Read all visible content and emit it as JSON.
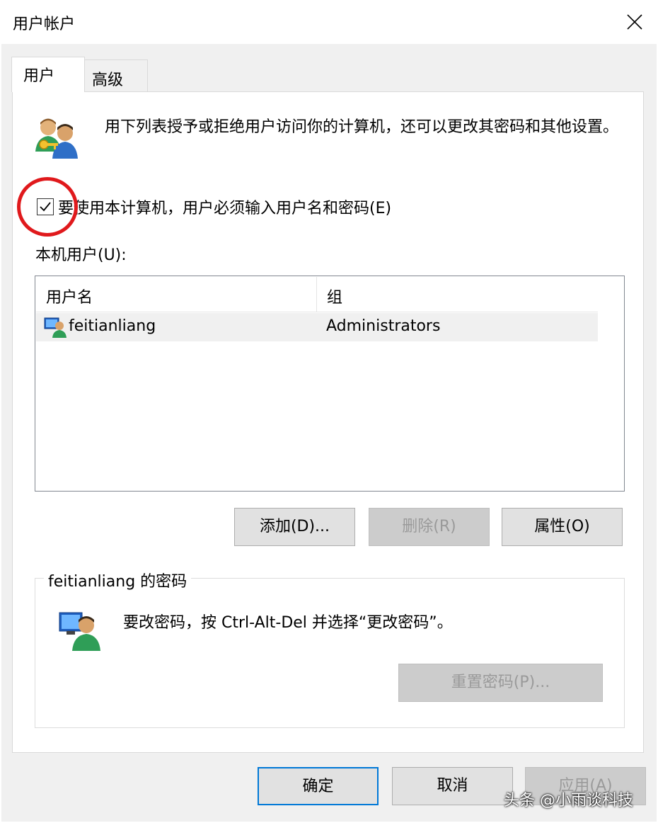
{
  "window": {
    "title": "用户帐户"
  },
  "tabs": [
    {
      "label": "用户",
      "active": true
    },
    {
      "label": "高级",
      "active": false
    }
  ],
  "description": "用下列表授予或拒绝用户访问你的计算机，还可以更改其密码和其他设置。",
  "require_login": {
    "label": "要使用本计算机，用户必须输入用户名和密码(E)",
    "checked": true
  },
  "local_users": {
    "label": "本机用户(U):",
    "columns": [
      "用户名",
      "组"
    ],
    "rows": [
      {
        "name": "feitianliang",
        "group": "Administrators"
      }
    ]
  },
  "user_buttons": {
    "add": "添加(D)...",
    "remove": "删除(R)",
    "properties": "属性(O)"
  },
  "password_group": {
    "title": "feitianliang 的密码",
    "text": "要改密码，按 Ctrl-Alt-Del 并选择“更改密码”。",
    "reset_button": "重置密码(P)..."
  },
  "dialog_buttons": {
    "ok": "确定",
    "cancel": "取消",
    "apply": "应用(A)"
  },
  "watermark": "头条 @小雨谈科技",
  "colors": {
    "highlight_circle": "#e0191c",
    "focus_border": "#0078d7"
  },
  "icons": {
    "users_icon": "users-key-icon",
    "row_icon": "user-computer-icon",
    "password_icon": "user-computer-icon"
  }
}
